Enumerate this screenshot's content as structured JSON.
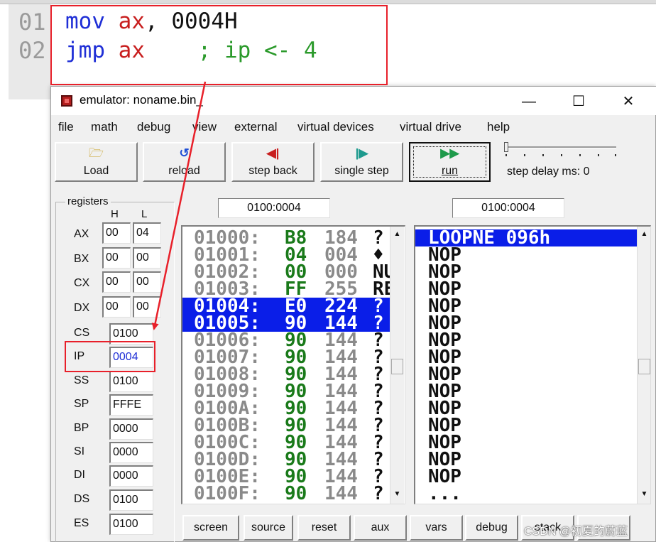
{
  "editor": {
    "line_numbers": [
      "01",
      "02"
    ],
    "line1": {
      "kw": "mov",
      "reg": "ax",
      "rest": ", 0004H"
    },
    "line2": {
      "kw": "jmp",
      "reg": "ax",
      "comment": "; ip <- 4"
    }
  },
  "window": {
    "title": "emulator: noname.bin_",
    "minimize": "—",
    "maximize": "☐",
    "close": "✕"
  },
  "menu": [
    "file",
    "math",
    "debug",
    "view",
    "external",
    "virtual devices",
    "virtual drive",
    "help"
  ],
  "toolbar": {
    "load": "Load",
    "reload": "reload",
    "step_back": "step back",
    "single_step": "single step",
    "run": "run",
    "step_delay": "step delay ms: 0"
  },
  "registers": {
    "title": "registers",
    "h": "H",
    "l": "L",
    "split": [
      {
        "name": "AX",
        "h": "00",
        "l": "04"
      },
      {
        "name": "BX",
        "h": "00",
        "l": "00"
      },
      {
        "name": "CX",
        "h": "00",
        "l": "00"
      },
      {
        "name": "DX",
        "h": "00",
        "l": "00"
      }
    ],
    "full": [
      {
        "name": "CS",
        "value": "0100"
      },
      {
        "name": "IP",
        "value": "0004"
      },
      {
        "name": "SS",
        "value": "0100"
      },
      {
        "name": "SP",
        "value": "FFFE"
      },
      {
        "name": "BP",
        "value": "0000"
      },
      {
        "name": "SI",
        "value": "0000"
      },
      {
        "name": "DI",
        "value": "0000"
      },
      {
        "name": "DS",
        "value": "0100"
      },
      {
        "name": "ES",
        "value": "0100"
      }
    ]
  },
  "memory": {
    "address": "0100:0004",
    "rows": [
      {
        "addr": "01000:",
        "hex": "B8",
        "dec": "184",
        "chr": "?",
        "selected": false
      },
      {
        "addr": "01001:",
        "hex": "04",
        "dec": "004",
        "chr": "♦",
        "selected": false
      },
      {
        "addr": "01002:",
        "hex": "00",
        "dec": "000",
        "chr": "NU",
        "selected": false
      },
      {
        "addr": "01003:",
        "hex": "FF",
        "dec": "255",
        "chr": "RE",
        "selected": false
      },
      {
        "addr": "01004:",
        "hex": "E0",
        "dec": "224",
        "chr": "?",
        "selected": true
      },
      {
        "addr": "01005:",
        "hex": "90",
        "dec": "144",
        "chr": "?",
        "selected": true
      },
      {
        "addr": "01006:",
        "hex": "90",
        "dec": "144",
        "chr": "?",
        "selected": false
      },
      {
        "addr": "01007:",
        "hex": "90",
        "dec": "144",
        "chr": "?",
        "selected": false
      },
      {
        "addr": "01008:",
        "hex": "90",
        "dec": "144",
        "chr": "?",
        "selected": false
      },
      {
        "addr": "01009:",
        "hex": "90",
        "dec": "144",
        "chr": "?",
        "selected": false
      },
      {
        "addr": "0100A:",
        "hex": "90",
        "dec": "144",
        "chr": "?",
        "selected": false
      },
      {
        "addr": "0100B:",
        "hex": "90",
        "dec": "144",
        "chr": "?",
        "selected": false
      },
      {
        "addr": "0100C:",
        "hex": "90",
        "dec": "144",
        "chr": "?",
        "selected": false
      },
      {
        "addr": "0100D:",
        "hex": "90",
        "dec": "144",
        "chr": "?",
        "selected": false
      },
      {
        "addr": "0100E:",
        "hex": "90",
        "dec": "144",
        "chr": "?",
        "selected": false
      },
      {
        "addr": "0100F:",
        "hex": "90",
        "dec": "144",
        "chr": "?",
        "selected": false
      }
    ]
  },
  "disassembly": {
    "address": "0100:0004",
    "rows": [
      "LOOPNE 096h",
      "NOP",
      "NOP",
      "NOP",
      "NOP",
      "NOP",
      "NOP",
      "NOP",
      "NOP",
      "NOP",
      "NOP",
      "NOP",
      "NOP",
      "NOP",
      "NOP",
      "..."
    ]
  },
  "bottom_buttons": [
    "screen",
    "source",
    "reset",
    "aux",
    "vars",
    "debug",
    "stack",
    "flags"
  ],
  "watermark": "CSDN @初夏的蔚蓝",
  "colors": {
    "selection": "#0a1ee8",
    "annotation": "#e8202a",
    "keyword": "#1f2fd6",
    "register": "#c81e1e",
    "comment": "#2b9a2b"
  }
}
